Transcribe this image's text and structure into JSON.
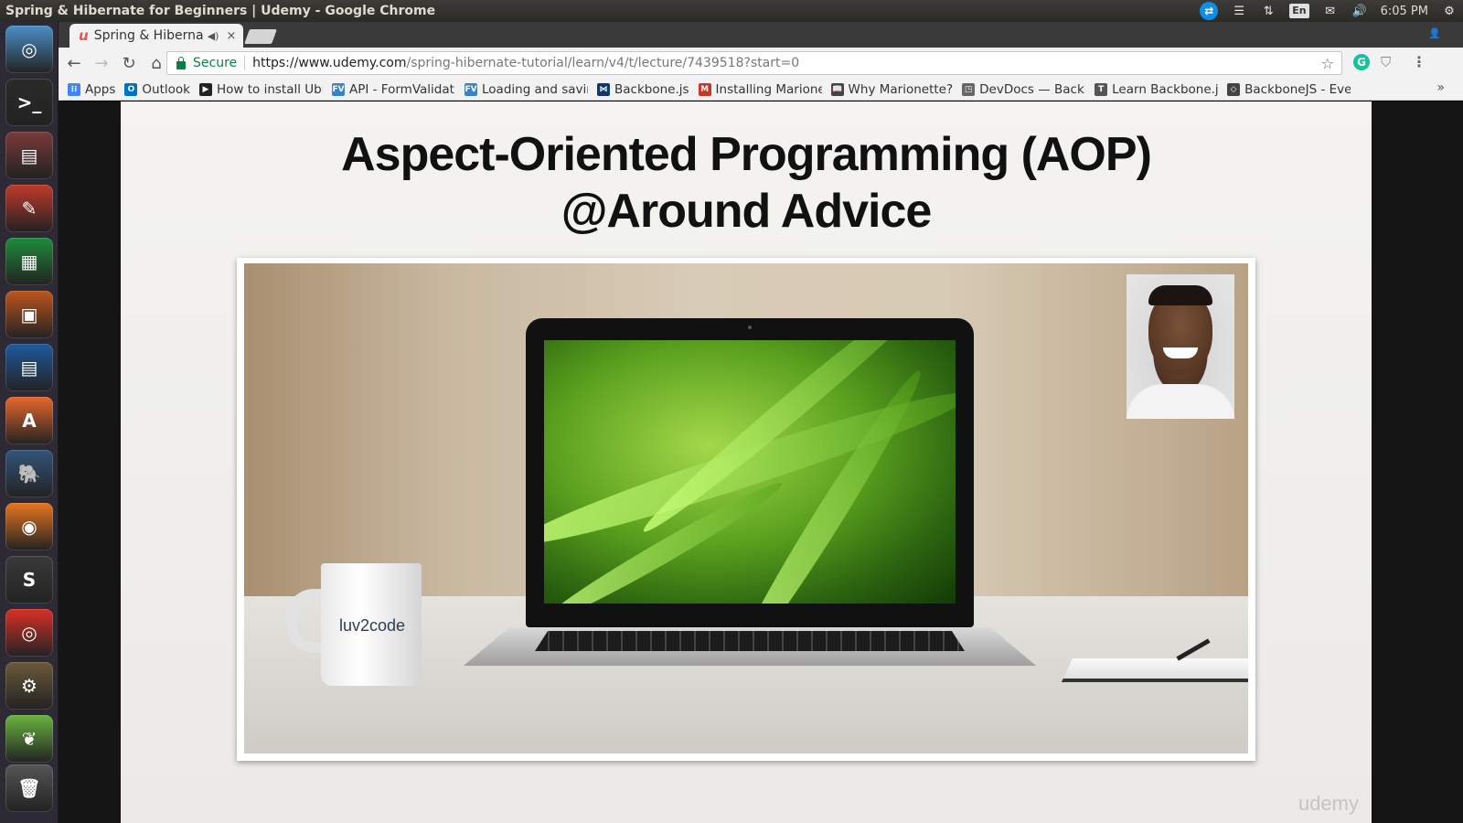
{
  "system": {
    "window_title": "Spring & Hibernate for Beginners | Udemy - Google Chrome",
    "keyboard_layout": "En",
    "clock": "6:05 PM"
  },
  "launcher": {
    "items": [
      {
        "name": "ubuntu-dash-icon",
        "glyph": "◎",
        "color": "#4a90c8"
      },
      {
        "name": "terminal-icon",
        "glyph": ">_",
        "color": "#2b2b2b"
      },
      {
        "name": "files-icon",
        "glyph": "▤",
        "color": "#7a3a3a"
      },
      {
        "name": "system-settings-icon",
        "glyph": "✎",
        "color": "#c0392b"
      },
      {
        "name": "libreoffice-calc-icon",
        "glyph": "▦",
        "color": "#1e8b3a"
      },
      {
        "name": "libreoffice-impress-icon",
        "glyph": "▣",
        "color": "#c0561d"
      },
      {
        "name": "libreoffice-writer-icon",
        "glyph": "▤",
        "color": "#1e5a9e"
      },
      {
        "name": "ubuntu-software-icon",
        "glyph": "A",
        "color": "#e8672c"
      },
      {
        "name": "postgresql-icon",
        "glyph": "🐘",
        "color": "#33567a"
      },
      {
        "name": "firefox-icon",
        "glyph": "◉",
        "color": "#e6761f"
      },
      {
        "name": "sublime-text-icon",
        "glyph": "S",
        "color": "#3a3a3a"
      },
      {
        "name": "chrome-icon",
        "glyph": "◎",
        "color": "#d93025"
      },
      {
        "name": "eclipse-java-ee-icon",
        "glyph": "⚙",
        "color": "#6b5a3a"
      },
      {
        "name": "spring-icon",
        "glyph": "❦",
        "color": "#6ab33f"
      },
      {
        "name": "trash-icon",
        "glyph": "🗑",
        "color": "#555555"
      }
    ]
  },
  "tab": {
    "favicon": "u",
    "title": "Spring & Hibernate",
    "mute_glyph": "◀)",
    "close_glyph": "×"
  },
  "toolbar": {
    "back": "←",
    "forward": "→",
    "reload": "↻",
    "home": "⌂",
    "secure_label": "Secure",
    "url_host": "https://www.udemy.com",
    "url_path": "/spring-hibernate-tutorial/learn/v4/t/lecture/7439518?start=0",
    "star": "☆",
    "grammarly": "G",
    "shield": "⛉",
    "menu": "⋮"
  },
  "bookmarks": [
    {
      "name": "apps",
      "label": "Apps",
      "icon_color": "#4285f4",
      "icon_text": "⁝⁝"
    },
    {
      "name": "outlook",
      "label": "Outlook",
      "icon_color": "#0072c6",
      "icon_text": "O"
    },
    {
      "name": "install-ubuntu",
      "label": "How to install Ubu",
      "icon_color": "#222222",
      "icon_text": "▶"
    },
    {
      "name": "formvalidation-api",
      "label": "API - FormValidati",
      "icon_color": "#3b82c4",
      "icon_text": "FV"
    },
    {
      "name": "loading-saving",
      "label": "Loading and savin",
      "icon_color": "#3b82c4",
      "icon_text": "FV"
    },
    {
      "name": "backbonejs",
      "label": "Backbone.js",
      "icon_color": "#0d3a6b",
      "icon_text": "⋈"
    },
    {
      "name": "installing-marionette",
      "label": "Installing Marione",
      "icon_color": "#c0392b",
      "icon_text": "M"
    },
    {
      "name": "why-marionette",
      "label": "Why Marionette?",
      "icon_color": "#444444",
      "icon_text": "📖"
    },
    {
      "name": "devdocs",
      "label": "DevDocs — Backb",
      "icon_color": "#666666",
      "icon_text": "◳"
    },
    {
      "name": "learn-backbone",
      "label": "Learn Backbone.js",
      "icon_color": "#555555",
      "icon_text": "T"
    },
    {
      "name": "backbonejs-events",
      "label": "BackboneJS - Ever",
      "icon_color": "#444444",
      "icon_text": "◇"
    }
  ],
  "bookmarks_overflow": "»",
  "slide": {
    "title_line1": "Aspect-Oriented Programming (AOP)",
    "title_line2": "@Around Advice",
    "mug_logo": "luv2code",
    "watermark": "udemy"
  }
}
